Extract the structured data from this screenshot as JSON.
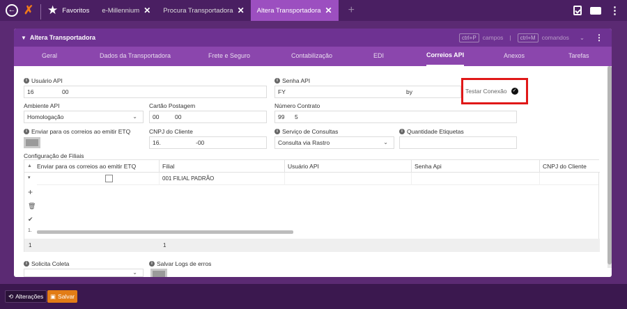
{
  "topbar": {
    "favorites_label": "Favoritos",
    "tabs": [
      {
        "label": "e-Millennium"
      },
      {
        "label": "Procura Transportadora"
      },
      {
        "label": "Altera Transportadora"
      }
    ],
    "add_tab": "+",
    "close_glyph": "✕"
  },
  "panel": {
    "title": "Altera Transportadora",
    "shortcut1_key": "ctrl+P",
    "shortcut1_label": "campos",
    "shortcut2_key": "ctrl+M",
    "shortcut2_label": "comandos"
  },
  "tabs": [
    {
      "label": "Geral"
    },
    {
      "label": "Dados da Transportadora"
    },
    {
      "label": "Frete e Seguro"
    },
    {
      "label": "Contabilização"
    },
    {
      "label": "EDI"
    },
    {
      "label": "Correios API"
    },
    {
      "label": "Anexos"
    },
    {
      "label": "Tarefas"
    }
  ],
  "form": {
    "usuario_api_label": "Usuário API",
    "usuario_api_value_a": "16",
    "usuario_api_value_b": "00",
    "senha_api_label": "Senha API",
    "senha_api_value_a": "FY",
    "senha_api_value_b": "by",
    "testar_conexao": "Testar Conexão",
    "ambiente_api_label": "Ambiente API",
    "ambiente_api_value": "Homologação",
    "cartao_postagem_label": "Cartão Postagem",
    "cartao_postagem_value_a": "00",
    "cartao_postagem_value_b": "00",
    "numero_contrato_label": "Número Contrato",
    "numero_contrato_value_a": "99",
    "numero_contrato_value_b": "5",
    "enviar_correios_label": "Enviar para os correios ao emitir ETQ",
    "cnpj_cliente_label": "CNPJ do Cliente",
    "cnpj_cliente_value_a": "16.",
    "cnpj_cliente_value_b": "-00",
    "servico_consultas_label": "Serviço de Consultas",
    "servico_consultas_value": "Consulta via Rastro",
    "quantidade_etiquetas_label": "Quantidade Etiquetas",
    "configuracao_filiais_label": "Configuração de Filiais",
    "solicita_coleta_label": "Solicita Coleta",
    "salvar_logs_label": "Salvar Logs de erros"
  },
  "grid": {
    "columns": [
      "Enviar para os correios ao emitir ETQ",
      "Filial",
      "Usuário API",
      "Senha Api",
      "CNPJ do Cliente"
    ],
    "rows": [
      {
        "enviar": false,
        "filial": "001 FILIAL PADRÃO",
        "usuario_api": "",
        "senha_api": "",
        "cnpj": ""
      }
    ],
    "footer_left": "1",
    "footer_count": "1",
    "row_marker": "1."
  },
  "bottom": {
    "alteracoes_label": "Alterações",
    "salvar_label": "Salvar"
  },
  "colors": {
    "accent": "#8b46ad",
    "header": "#6e3292",
    "save": "#e27c16",
    "highlight": "#e01818"
  }
}
